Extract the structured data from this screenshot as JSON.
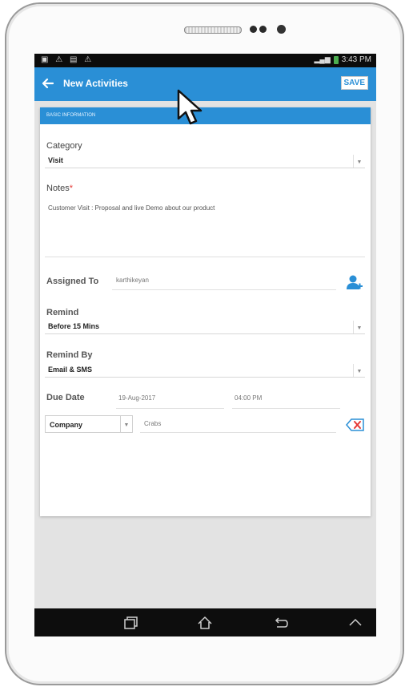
{
  "device": {
    "status_bar": {
      "left_icons": "▣ ⚠ ▤ ⚠",
      "time": "3:43 PM"
    },
    "nav_bar": {
      "buttons": [
        "recent-apps",
        "home",
        "back",
        "up"
      ]
    }
  },
  "app_bar": {
    "title": "New Activities",
    "save_label": "SAVE",
    "color": "#2a8fd6"
  },
  "form": {
    "section_title": "BASIC INFORMATION",
    "category": {
      "label": "Category",
      "value": "Visit"
    },
    "notes": {
      "label": "Notes",
      "required_mark": "*",
      "value": "Customer Visit : Proposal and live Demo about our product"
    },
    "assigned_to": {
      "label": "Assigned To",
      "value": "karthikeyan"
    },
    "remind": {
      "label": "Remind",
      "value": "Before 15 Mins"
    },
    "remind_by": {
      "label": "Remind By",
      "value": "Email & SMS"
    },
    "due_date": {
      "label": "Due Date",
      "date": "19-Aug-2017",
      "time": "04:00 PM"
    },
    "related": {
      "type": "Company",
      "value": "Crabs"
    }
  },
  "icons": {
    "back": "back-arrow-icon",
    "assign": "person-icon",
    "clear": "clear-icon",
    "dropdown": "chevron-down-icon"
  }
}
